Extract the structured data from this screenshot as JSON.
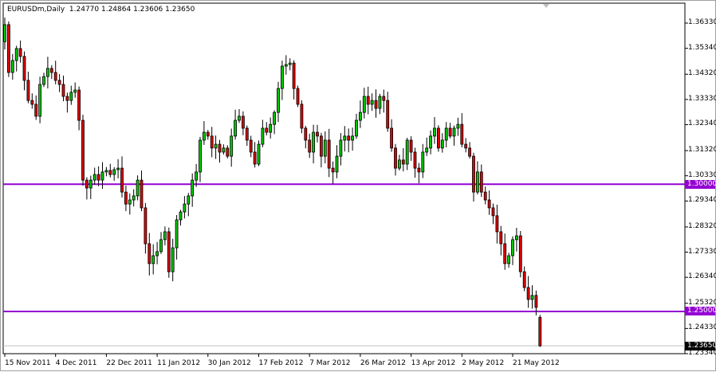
{
  "header": {
    "symbol": "EURUSDm,Daily",
    "ohlc": "1.24770 1.24864 1.23606 1.23650"
  },
  "colors": {
    "bull": "#00c800",
    "bear": "#e00000",
    "level": "#9400d3",
    "current_price_bg": "#000000",
    "grid_border": "#000000"
  },
  "chart_data": {
    "type": "candlestick",
    "title": "EURUSDm,Daily",
    "ylim": [
      1.2334,
      1.3633
    ],
    "y_ticks": [
      "1.36330",
      "1.35340",
      "1.34320",
      "1.33330",
      "1.32340",
      "1.31320",
      "1.30330",
      "1.29340",
      "1.28320",
      "1.27330",
      "1.26340",
      "1.25320",
      "1.24330",
      "1.23340"
    ],
    "x_ticks": [
      {
        "label": "15 Nov 2011",
        "index": 0
      },
      {
        "label": "4 Dec 2011",
        "index": 13
      },
      {
        "label": "22 Dec 2011",
        "index": 26
      },
      {
        "label": "11 Jan 2012",
        "index": 39
      },
      {
        "label": "30 Jan 2012",
        "index": 52
      },
      {
        "label": "17 Feb 2012",
        "index": 65
      },
      {
        "label": "7 Mar 2012",
        "index": 78
      },
      {
        "label": "26 Mar 2012",
        "index": 91
      },
      {
        "label": "13 Apr 2012",
        "index": 104
      },
      {
        "label": "2 May 2012",
        "index": 117
      },
      {
        "label": "21 May 2012",
        "index": 130
      }
    ],
    "horizontal_levels": [
      {
        "value": 1.3,
        "label": "1.30000"
      },
      {
        "value": 1.25,
        "label": "1.25000"
      }
    ],
    "current_price": {
      "value": 1.2365,
      "label": "1.23650"
    },
    "first_open": 1.356,
    "closes": [
      1.3627,
      1.3439,
      1.3486,
      1.3533,
      1.3502,
      1.3408,
      1.3329,
      1.3314,
      1.3267,
      1.3392,
      1.3423,
      1.3455,
      1.3439,
      1.3408,
      1.3392,
      1.3345,
      1.3329,
      1.3361,
      1.337,
      1.3251,
      1.3016,
      1.2985,
      1.3016,
      1.3038,
      1.3016,
      1.3048,
      1.3054,
      1.3038,
      1.3057,
      1.3063,
      1.2969,
      1.2922,
      1.2938,
      1.2954,
      1.3016,
      1.2907,
      1.2766,
      1.2688,
      1.2719,
      1.2735,
      1.2782,
      1.2813,
      1.2656,
      1.275,
      1.286,
      1.2891,
      1.2922,
      1.2954,
      1.3016,
      1.3048,
      1.3173,
      1.3204,
      1.3189,
      1.3142,
      1.3157,
      1.3126,
      1.3142,
      1.311,
      1.3189,
      1.3251,
      1.3267,
      1.322,
      1.3173,
      1.3126,
      1.3079,
      1.3157,
      1.322,
      1.3204,
      1.3235,
      1.3282,
      1.3376,
      1.3464,
      1.347,
      1.3476,
      1.3376,
      1.3314,
      1.322,
      1.3173,
      1.3126,
      1.3204,
      1.3189,
      1.311,
      1.3173,
      1.3063,
      1.3048,
      1.311,
      1.3173,
      1.3189,
      1.3173,
      1.3189,
      1.3251,
      1.3282,
      1.3345,
      1.3314,
      1.3329,
      1.3298,
      1.3345,
      1.3329,
      1.322,
      1.3142,
      1.3063,
      1.3095,
      1.3079,
      1.3173,
      1.3126,
      1.3063,
      1.3048,
      1.3126,
      1.3142,
      1.3189,
      1.322,
      1.3142,
      1.3173,
      1.322,
      1.3189,
      1.322,
      1.3235,
      1.3157,
      1.3142,
      1.311,
      1.2969,
      1.3048,
      1.2969,
      1.2938,
      1.2907,
      1.2876,
      1.2813,
      1.2766,
      1.2688,
      1.2719,
      1.2782,
      1.2797,
      1.2656,
      1.2594,
      1.2547,
      1.2563,
      1.2516
    ],
    "last_candle": {
      "open": 1.2477,
      "high": 1.24864,
      "low": 1.23606,
      "close": 1.2365
    }
  }
}
